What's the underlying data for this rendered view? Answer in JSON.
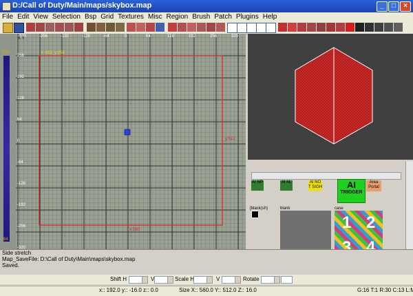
{
  "window": {
    "title": "D:/Call of Duty/Main/maps/skybox.map",
    "minimize": "_",
    "maximize": "□",
    "close": "×"
  },
  "menu": [
    "File",
    "Edit",
    "View",
    "Selection",
    "Bsp",
    "Grid",
    "Textures",
    "Misc",
    "Region",
    "Brush",
    "Patch",
    "Plugins",
    "Help"
  ],
  "grid": {
    "view_label": "X Y",
    "x_ticks": [
      "-320",
      "-256",
      "-192",
      "-128",
      "-64",
      "0",
      "64",
      "128",
      "192",
      "256",
      "320"
    ],
    "y_ticks": [
      "256",
      "192",
      "128",
      "64",
      "0",
      "-64",
      "-128",
      "-192",
      "-256",
      "-320"
    ],
    "brush_top_label": "x:-312, y:256",
    "brush_right_label": "y:512",
    "brush_bottom_label": "x:560",
    "left_ticks": [
      "512",
      "-64"
    ],
    "colors": {
      "grid_bg": "#9aa092",
      "brush_outline": "#e02020",
      "selection": "#3040d0"
    }
  },
  "camera": {
    "colors": {
      "background": "#404040",
      "brush": "#c62828",
      "edge": "#ffffff"
    }
  },
  "textures": {
    "items": [
      {
        "label": "AI NP",
        "color": "#2e7d32"
      },
      {
        "label": "AI AL",
        "color": "#2e7d32"
      },
      {
        "label": "AI NO T SIGH",
        "color": "#f2e200"
      },
      {
        "label": "Area Portal",
        "color": "#e6a070"
      }
    ],
    "trigger_logo_top": "AI",
    "trigger_logo_bottom": "TRIGGER",
    "black_label": "[black(sh)",
    "blank_label": "blank",
    "case_label": "case",
    "case_numbers": [
      "1",
      "2",
      "3",
      "4"
    ]
  },
  "console": [
    "Side stretch",
    "Map_SaveFile: D:\\Call of Duty\\Main\\maps\\skybox.map",
    "Saved."
  ],
  "controls": {
    "shift_h": "Shift H",
    "v1": "V",
    "scale_h": "Scale H",
    "v2": "V",
    "rotate": "Rotate"
  },
  "status": {
    "coords": "x:: 192.0  y:: -16.0  z:: 0.0",
    "size": "Size X:: 560.0  Y:: 512.0  Z:: 16.0",
    "grid_info": "G:16 T:1 R:30 C:13 L:M"
  }
}
